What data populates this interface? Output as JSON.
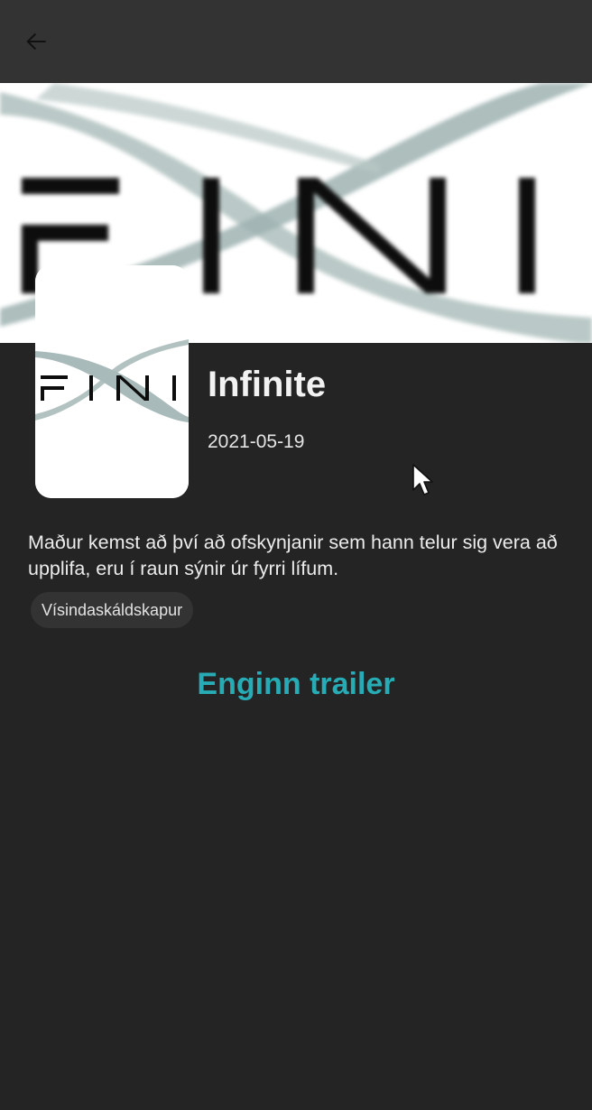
{
  "app_bar": {
    "back_icon": "arrow-left-icon"
  },
  "backdrop": {
    "logo_text": "FINI",
    "background_color": "#ffffff",
    "swoosh_color": "#9fb3b1"
  },
  "poster": {
    "logo_text": "FINI"
  },
  "movie": {
    "title": "Infinite",
    "release_date": "2021-05-19",
    "overview": "Maður kemst að því að ofskynjanir sem hann telur sig vera að upplifa, eru í raun sýnir úr fyrri lífum.",
    "genres": [
      "Vísindaskáldskapur"
    ]
  },
  "trailer": {
    "label": "Enginn trailer",
    "color": "#27abb4"
  },
  "colors": {
    "background": "#242424",
    "app_bar": "#333333",
    "chip": "#333333"
  }
}
